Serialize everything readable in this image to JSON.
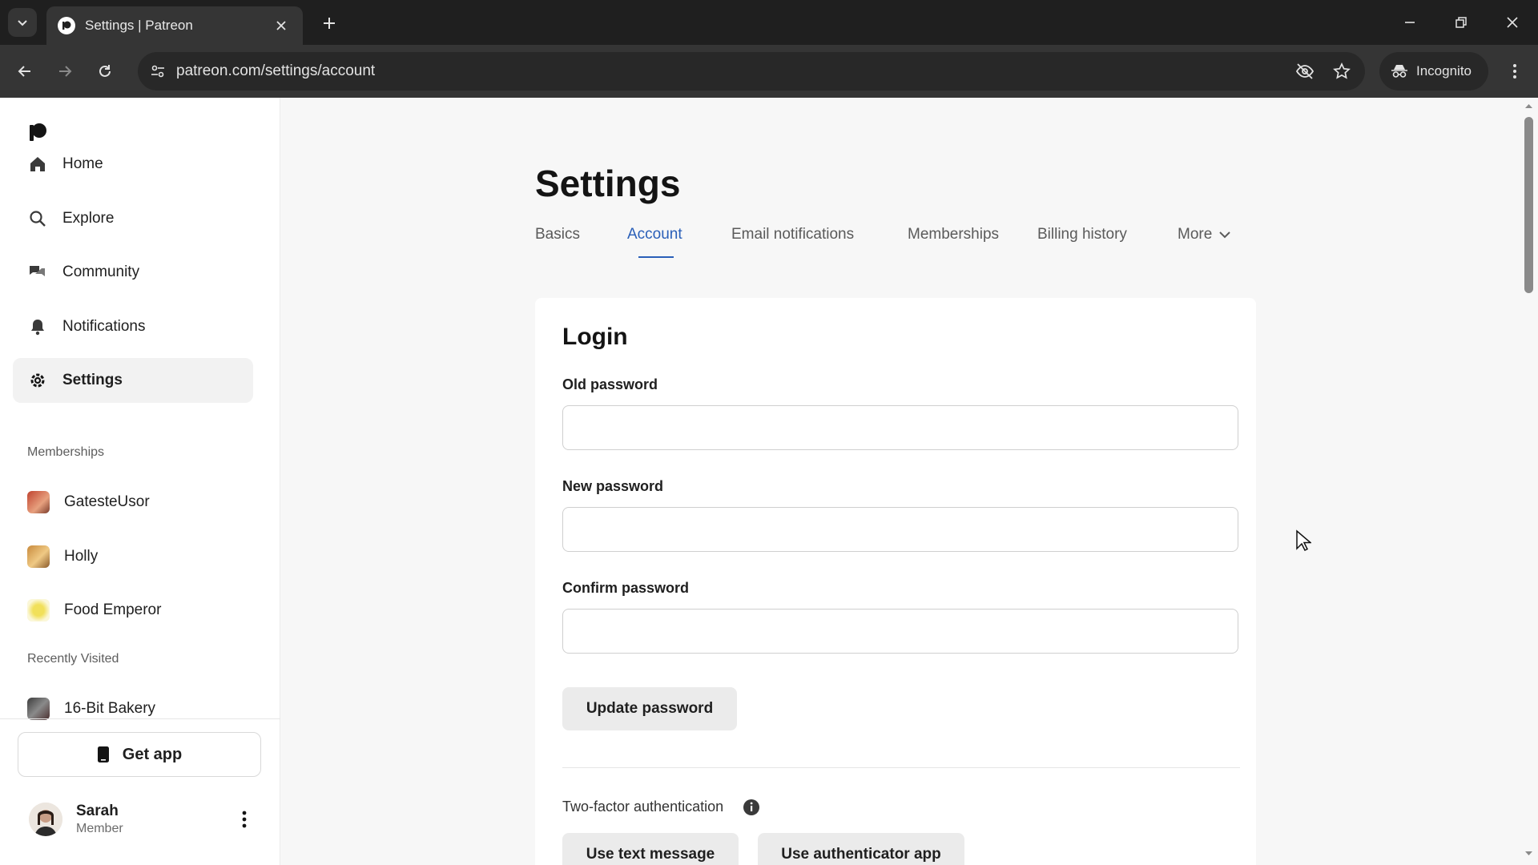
{
  "browser": {
    "tab_title": "Settings | Patreon",
    "url": "patreon.com/settings/account",
    "incognito_label": "Incognito"
  },
  "sidebar": {
    "nav": [
      {
        "label": "Home",
        "icon": "home-icon"
      },
      {
        "label": "Explore",
        "icon": "search-icon"
      },
      {
        "label": "Community",
        "icon": "chat-icon"
      },
      {
        "label": "Notifications",
        "icon": "bell-icon"
      },
      {
        "label": "Settings",
        "icon": "gear-icon",
        "active": true
      }
    ],
    "memberships_heading": "Memberships",
    "memberships": [
      {
        "label": "GatesteUsor"
      },
      {
        "label": "Holly"
      },
      {
        "label": "Food Emperor"
      }
    ],
    "recent_heading": "Recently Visited",
    "recent": [
      {
        "label": "16-Bit Bakery"
      }
    ],
    "get_app_label": "Get app",
    "user": {
      "name": "Sarah",
      "role": "Member"
    }
  },
  "main": {
    "title": "Settings",
    "tabs": [
      {
        "label": "Basics"
      },
      {
        "label": "Account",
        "active": true
      },
      {
        "label": "Email notifications"
      },
      {
        "label": "Memberships"
      },
      {
        "label": "Billing history"
      },
      {
        "label": "More"
      }
    ],
    "login": {
      "title": "Login",
      "old_password_label": "Old password",
      "old_password_value": "",
      "new_password_label": "New password",
      "new_password_value": "",
      "confirm_password_label": "Confirm password",
      "confirm_password_value": "",
      "update_button": "Update password",
      "two_factor_label": "Two-factor authentication",
      "use_text_message": "Use text message",
      "use_authenticator_app": "Use authenticator app"
    }
  },
  "colors": {
    "accent": "#2a5fb8",
    "chrome_dark": "#1f1f1f",
    "chrome_toolbar": "#353535"
  }
}
